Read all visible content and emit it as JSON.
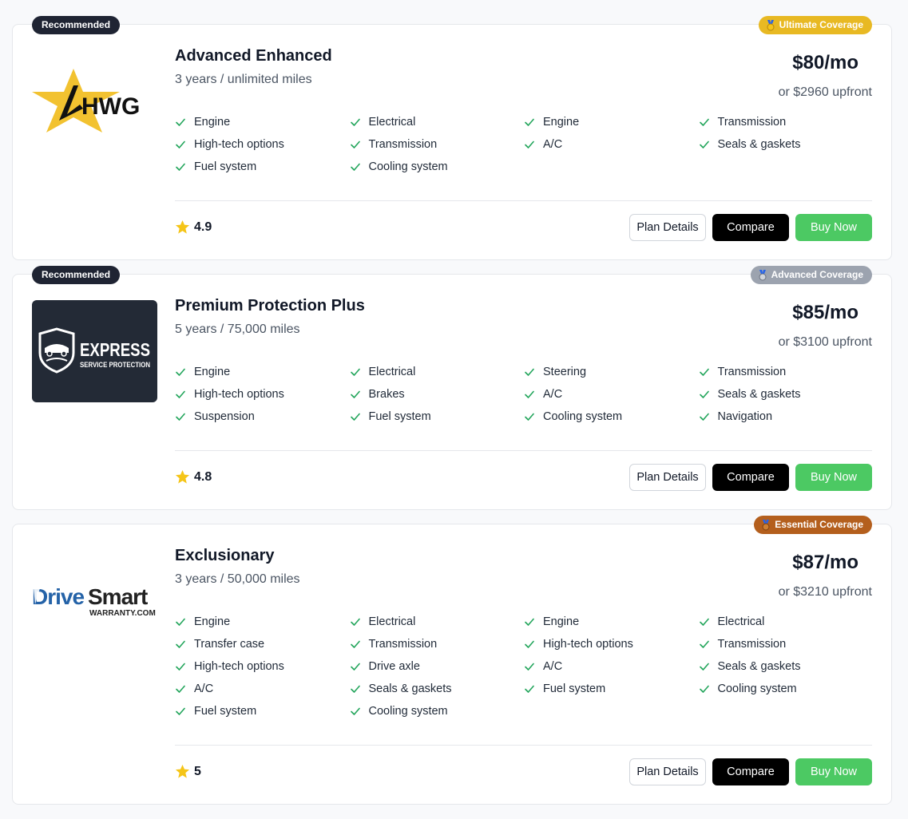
{
  "plans": [
    {
      "recommended_label": "Recommended",
      "coverage_label": "Ultimate Coverage",
      "coverage_color": "#e8b923",
      "medal_icon": "gold-medal-icon",
      "logo": {
        "text": "HWG",
        "icon": "hwg-star-logo"
      },
      "name": "Advanced Enhanced",
      "term": "3 years / unlimited miles",
      "price": "$80/mo",
      "upfront": "or $2960 upfront",
      "features": [
        "Engine",
        "Electrical",
        "Engine",
        "Transmission",
        "High-tech options",
        "Transmission",
        "A/C",
        "Seals & gaskets",
        "Fuel system",
        "Cooling system"
      ],
      "rating": "4.9",
      "buttons": {
        "details": "Plan Details",
        "compare": "Compare",
        "buy": "Buy Now"
      }
    },
    {
      "recommended_label": "Recommended",
      "coverage_label": "Advanced Coverage",
      "coverage_color": "#9ca3af",
      "medal_icon": "silver-medal-icon",
      "logo": {
        "text": "EXPRESS",
        "subtext": "SERVICE PROTECTION",
        "icon": "express-shield-logo"
      },
      "name": "Premium Protection Plus",
      "term": "5 years / 75,000 miles",
      "price": "$85/mo",
      "upfront": "or $3100 upfront",
      "features": [
        "Engine",
        "Electrical",
        "Steering",
        "Transmission",
        "High-tech options",
        "Brakes",
        "A/C",
        "Seals & gaskets",
        "Suspension",
        "Fuel system",
        "Cooling system",
        "Navigation"
      ],
      "rating": "4.8",
      "buttons": {
        "details": "Plan Details",
        "compare": "Compare",
        "buy": "Buy Now"
      }
    },
    {
      "coverage_label": "Essential Coverage",
      "coverage_color": "#b45f1d",
      "medal_icon": "bronze-medal-icon",
      "logo": {
        "text_a": "Drive",
        "text_b": "Smart",
        "subtext": "WARRANTY.COM",
        "icon": "drivesmart-logo"
      },
      "name": "Exclusionary",
      "term": "3 years / 50,000 miles",
      "price": "$87/mo",
      "upfront": "or $3210 upfront",
      "features": [
        "Engine",
        "Electrical",
        "Engine",
        "Electrical",
        "Transfer case",
        "Transmission",
        "High-tech options",
        "Transmission",
        "High-tech options",
        "Drive axle",
        "A/C",
        "Seals & gaskets",
        "A/C",
        "Seals & gaskets",
        "Fuel system",
        "Cooling system",
        "Fuel system",
        "Cooling system"
      ],
      "rating": "5",
      "buttons": {
        "details": "Plan Details",
        "compare": "Compare",
        "buy": "Buy Now"
      }
    }
  ]
}
